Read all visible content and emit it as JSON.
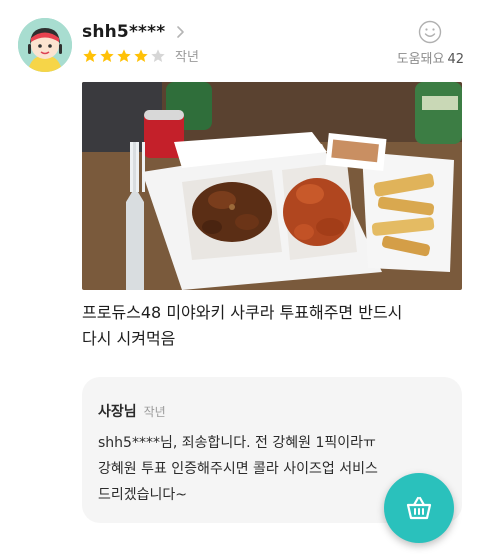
{
  "review": {
    "username": "shh5****",
    "rating": 4,
    "max_rating": 5,
    "date": "작년",
    "helpful_label": "도움돼요",
    "helpful_count": "42",
    "text_lines": [
      "프로듀스48 미야와키 사쿠라 투표해주면 반드시",
      "다시 시켜먹음"
    ]
  },
  "owner_reply": {
    "name": "사장님",
    "date": "작년",
    "text_lines": [
      "shh5****님, 죄송합니다. 전 강혜원 1픽이라ㅠ",
      "강혜원 투표 인증해주시면 콜라 사이즈업 서비스",
      "드리겠습니다~"
    ]
  },
  "colors": {
    "accent": "#2ac1bc",
    "star_filled": "#ffc107",
    "star_empty": "#d6d6d6",
    "reply_bg": "#f5f5f5"
  },
  "icons": {
    "chevron": "chevron-right-icon",
    "helpful": "smiley-icon",
    "cart": "basket-icon"
  }
}
